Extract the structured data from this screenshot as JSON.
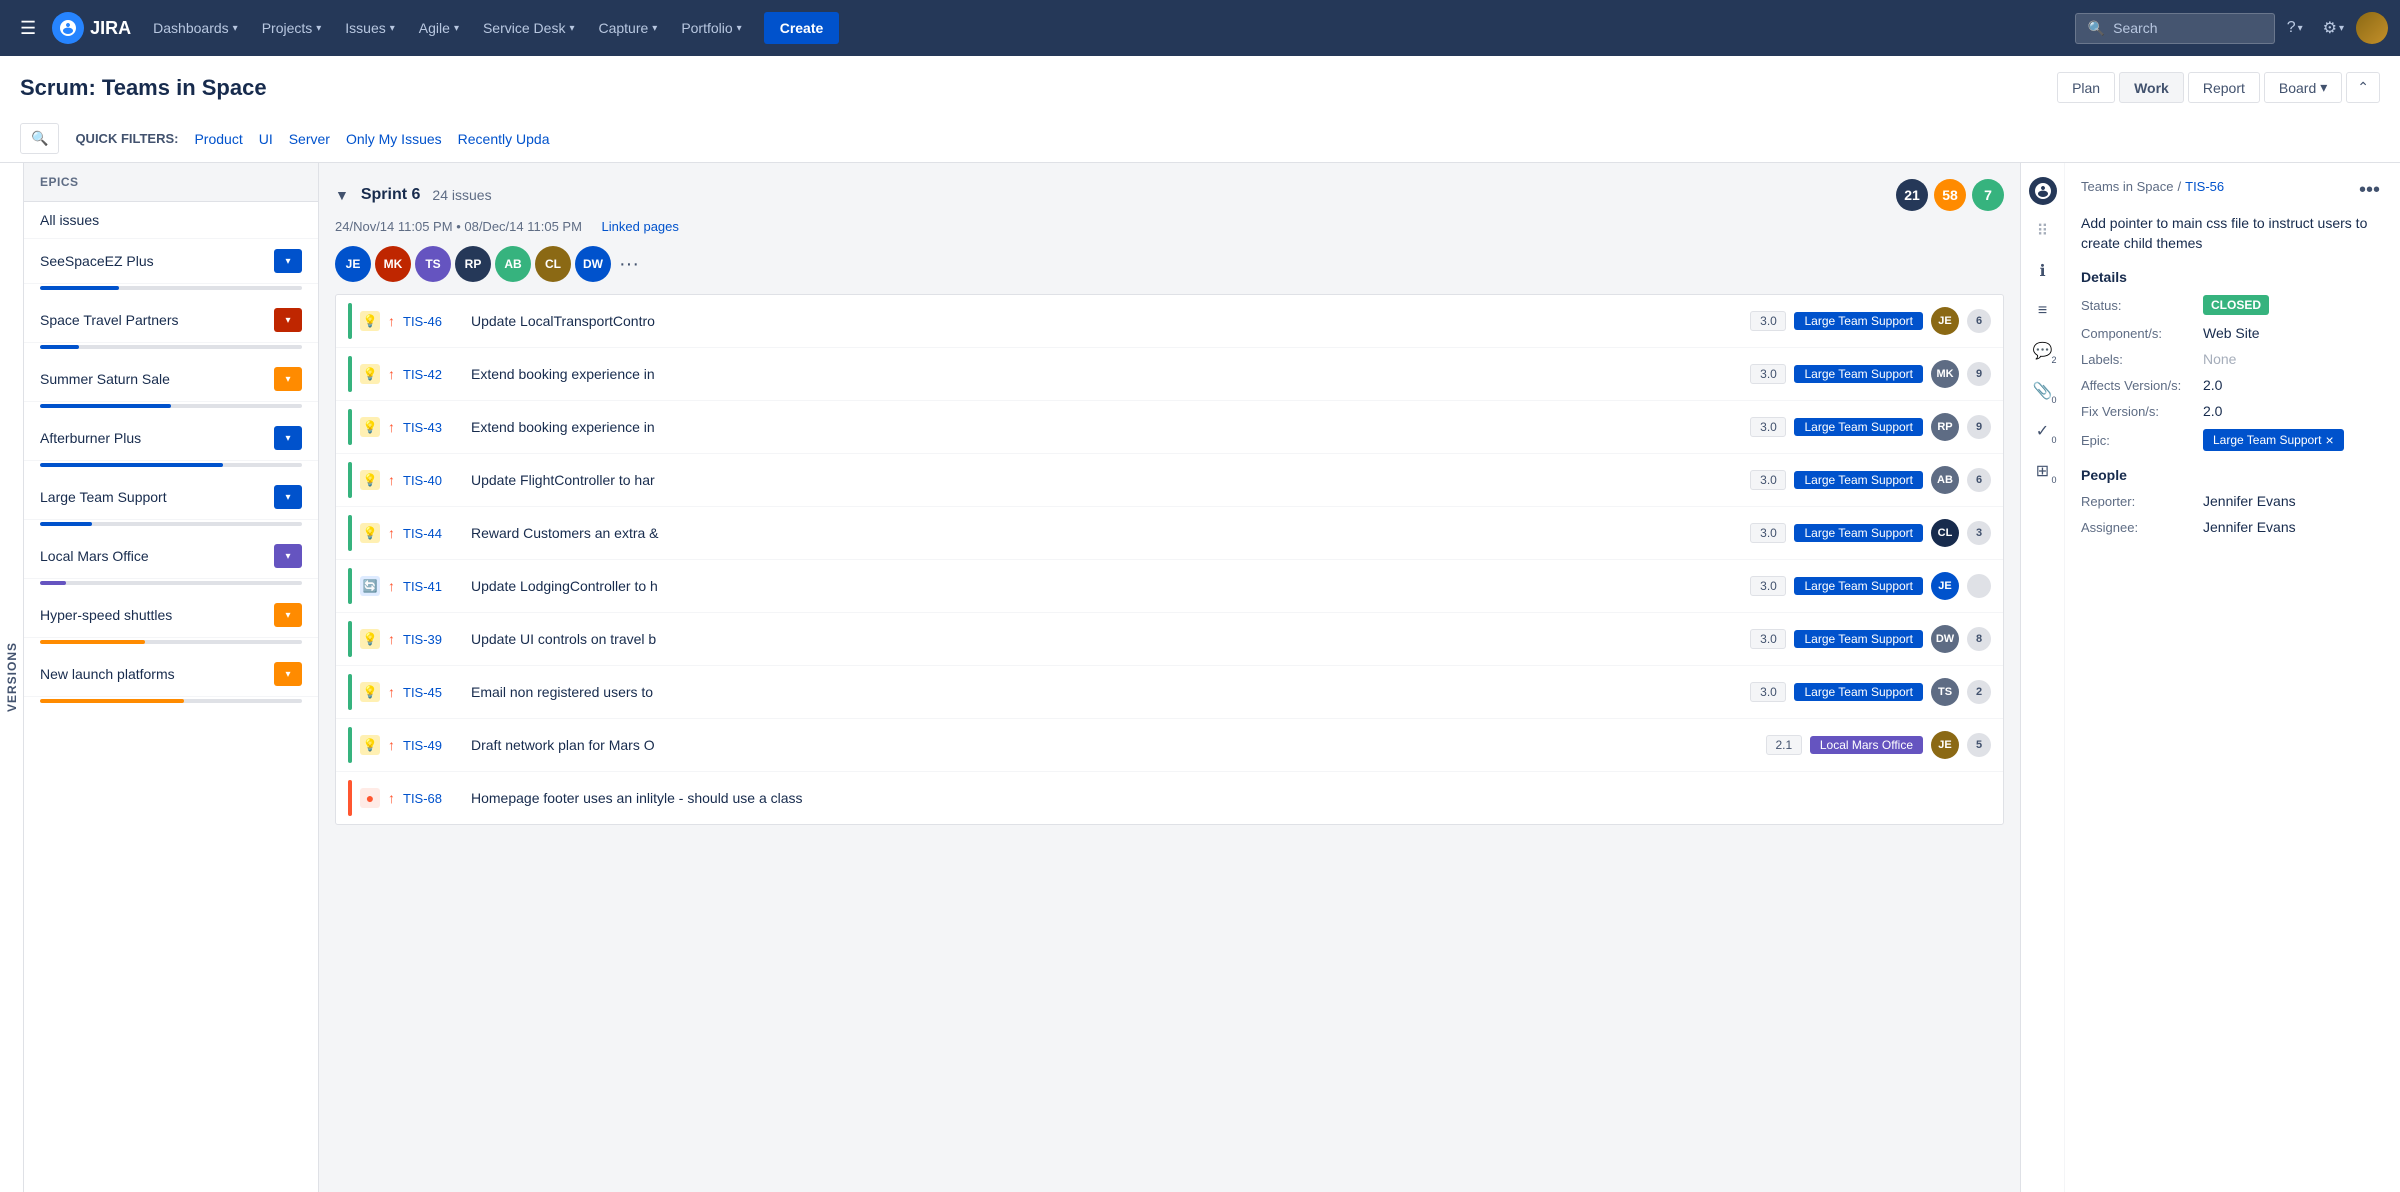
{
  "nav": {
    "hamburger": "☰",
    "logo_text": "JIRA",
    "items": [
      {
        "label": "Dashboards",
        "has_arrow": true
      },
      {
        "label": "Projects",
        "has_arrow": true
      },
      {
        "label": "Issues",
        "has_arrow": true
      },
      {
        "label": "Agile",
        "has_arrow": true
      },
      {
        "label": "Service Desk",
        "has_arrow": true
      },
      {
        "label": "Capture",
        "has_arrow": true
      },
      {
        "label": "Portfolio",
        "has_arrow": true
      }
    ],
    "create_label": "Create",
    "search_placeholder": "Search",
    "help_icon": "?",
    "settings_icon": "⚙"
  },
  "page": {
    "title": "Scrum: Teams in Space"
  },
  "view_buttons": [
    {
      "label": "Plan",
      "active": false
    },
    {
      "label": "Work",
      "active": true
    },
    {
      "label": "Report",
      "active": false
    },
    {
      "label": "Board",
      "active": false,
      "has_arrow": true
    }
  ],
  "quick_filters": {
    "label": "QUICK FILTERS:",
    "items": [
      {
        "label": "Product"
      },
      {
        "label": "UI"
      },
      {
        "label": "Server"
      },
      {
        "label": "Only My Issues"
      },
      {
        "label": "Recently Upda"
      }
    ]
  },
  "epics": {
    "header": "EPICS",
    "items": [
      {
        "name": "All issues",
        "color": null,
        "progress": 0
      },
      {
        "name": "SeeSpaceEZ Plus",
        "color": "#0052CC",
        "progress": 30,
        "btn_color": "#0052CC"
      },
      {
        "name": "Space Travel Partners",
        "color": "#BF2600",
        "progress": 15,
        "btn_color": "#BF2600"
      },
      {
        "name": "Summer Saturn Sale",
        "color": "#FF8B00",
        "progress": 50,
        "btn_color": "#FF8B00"
      },
      {
        "name": "Afterburner Plus",
        "color": "#0052CC",
        "progress": 70,
        "btn_color": "#0052CC"
      },
      {
        "name": "Large Team Support",
        "color": "#0052CC",
        "progress": 20,
        "btn_color": "#0052CC"
      },
      {
        "name": "Local Mars Office",
        "color": "#6554C0",
        "progress": 10,
        "btn_color": "#6554C0"
      },
      {
        "name": "Hyper-speed shuttles",
        "color": "#FF8B00",
        "progress": 40,
        "btn_color": "#FF8B00"
      },
      {
        "name": "New launch platforms",
        "color": "#FF8B00",
        "progress": 55,
        "btn_color": "#FF8B00"
      }
    ]
  },
  "sprint": {
    "name": "Sprint 6",
    "issue_count": "24 issues",
    "chevron": "▼",
    "badges": [
      {
        "count": "21",
        "color": "#253858"
      },
      {
        "count": "58",
        "color": "#FF8B00"
      },
      {
        "count": "7",
        "color": "#36B37E"
      }
    ],
    "date_start": "24/Nov/14 11:05 PM",
    "date_sep": "•",
    "date_end": "08/Dec/14 11:05 PM",
    "linked_pages": "Linked pages",
    "avatars": [
      {
        "initials": "JE",
        "color": "#0052CC"
      },
      {
        "initials": "MK",
        "color": "#BF2600"
      },
      {
        "initials": "TS",
        "color": "#6554C0"
      },
      {
        "initials": "RP",
        "color": "#253858"
      },
      {
        "initials": "AB",
        "color": "#36B37E"
      },
      {
        "initials": "CL",
        "color": "#8B6914"
      },
      {
        "initials": "DW",
        "color": "#0052CC"
      }
    ],
    "more_avatars": "..."
  },
  "issues": [
    {
      "left_color": "#36B37E",
      "type_icon": "💡",
      "type_color": "#FFF0B3",
      "priority": "↑",
      "priority_color": "#FF5630",
      "key": "TIS-46",
      "summary": "Update LocalTransportContro",
      "points": "3.0",
      "epic": "Large Team Support",
      "epic_color": "#0052CC",
      "assignee_initials": "JE",
      "assignee_color": "#8B6914",
      "story_pts": "6"
    },
    {
      "left_color": "#36B37E",
      "type_icon": "💡",
      "type_color": "#FFF0B3",
      "priority": "↑",
      "priority_color": "#FF5630",
      "key": "TIS-42",
      "summary": "Extend booking experience in",
      "points": "3.0",
      "epic": "Large Team Support",
      "epic_color": "#0052CC",
      "assignee_initials": "MK",
      "assignee_color": "#5E6C84",
      "story_pts": "9"
    },
    {
      "left_color": "#36B37E",
      "type_icon": "💡",
      "type_color": "#FFF0B3",
      "priority": "↑",
      "priority_color": "#FF5630",
      "key": "TIS-43",
      "summary": "Extend booking experience in",
      "points": "3.0",
      "epic": "Large Team Support",
      "epic_color": "#0052CC",
      "assignee_initials": "RP",
      "assignee_color": "#5E6C84",
      "story_pts": "9"
    },
    {
      "left_color": "#36B37E",
      "type_icon": "💡",
      "type_color": "#FFF0B3",
      "priority": "↑",
      "priority_color": "#FF5630",
      "key": "TIS-40",
      "summary": "Update FlightController to har",
      "points": "3.0",
      "epic": "Large Team Support",
      "epic_color": "#0052CC",
      "assignee_initials": "AB",
      "assignee_color": "#5E6C84",
      "story_pts": "6"
    },
    {
      "left_color": "#36B37E",
      "type_icon": "💡",
      "type_color": "#FFF0B3",
      "priority": "↑",
      "priority_color": "#FF5630",
      "key": "TIS-44",
      "summary": "Reward Customers an extra &",
      "points": "3.0",
      "epic": "Large Team Support",
      "epic_color": "#0052CC",
      "assignee_initials": "CL",
      "assignee_color": "#172B4D",
      "story_pts": "3"
    },
    {
      "left_color": "#36B37E",
      "type_icon": "🔄",
      "type_color": "#DEEBFF",
      "priority": "↑",
      "priority_color": "#FF5630",
      "key": "TIS-41",
      "summary": "Update LodgingController to h",
      "points": "3.0",
      "epic": "Large Team Support",
      "epic_color": "#0052CC",
      "assignee_initials": "JE",
      "assignee_color": "#0052CC",
      "story_pts": ""
    },
    {
      "left_color": "#36B37E",
      "type_icon": "💡",
      "type_color": "#FFF0B3",
      "priority": "↑",
      "priority_color": "#FF5630",
      "key": "TIS-39",
      "summary": "Update UI controls on travel b",
      "points": "3.0",
      "epic": "Large Team Support",
      "epic_color": "#0052CC",
      "assignee_initials": "DW",
      "assignee_color": "#5E6C84",
      "story_pts": "8"
    },
    {
      "left_color": "#36B37E",
      "type_icon": "💡",
      "type_color": "#FFF0B3",
      "priority": "↑",
      "priority_color": "#FF5630",
      "key": "TIS-45",
      "summary": "Email non registered users to",
      "points": "3.0",
      "epic": "Large Team Support",
      "epic_color": "#0052CC",
      "assignee_initials": "TS",
      "assignee_color": "#5E6C84",
      "story_pts": "2"
    },
    {
      "left_color": "#36B37E",
      "type_icon": "💡",
      "type_color": "#FFF0B3",
      "priority": "↑",
      "priority_color": "#FF5630",
      "key": "TIS-49",
      "summary": "Draft network plan for Mars O",
      "points": "2.1",
      "epic": "Local Mars Office",
      "epic_color": "#6554C0",
      "assignee_initials": "JE",
      "assignee_color": "#8B6914",
      "story_pts": "5"
    },
    {
      "left_color": "#FF5630",
      "type_icon": "🔴",
      "type_color": "#FFEBE6",
      "priority": "↑",
      "priority_color": "#FF5630",
      "key": "TIS-68",
      "summary": "Homepage footer uses an inlityle - should use a class",
      "points": "",
      "epic": "",
      "epic_color": "",
      "assignee_initials": "",
      "assignee_color": "",
      "story_pts": ""
    }
  ],
  "detail": {
    "breadcrumb_project": "Teams in Space",
    "breadcrumb_sep": "/",
    "breadcrumb_issue": "TIS-56",
    "more_btn": "•••",
    "description": "Add pointer to main css file to instruct users to create child themes",
    "section_details": "Details",
    "fields": [
      {
        "label": "Status:",
        "value": "CLOSED",
        "type": "status"
      },
      {
        "label": "Component/s:",
        "value": "Web Site",
        "type": "text"
      },
      {
        "label": "Labels:",
        "value": "None",
        "type": "none"
      },
      {
        "label": "Affects Version/s:",
        "value": "2.0",
        "type": "text"
      },
      {
        "label": "Fix Version/s:",
        "value": "2.0",
        "type": "text"
      },
      {
        "label": "Epic:",
        "value": "Large Team Support ×",
        "type": "epic"
      }
    ],
    "section_people": "People",
    "reporter_label": "Reporter:",
    "reporter_value": "Jennifer Evans",
    "assignee_label": "Assignee:",
    "assignee_value": "Jennifer Evans"
  },
  "side_icons": [
    {
      "icon": "⚙",
      "badge": ""
    },
    {
      "icon": "ℹ",
      "badge": ""
    },
    {
      "icon": "≡",
      "badge": ""
    },
    {
      "icon": "💬",
      "badge": "2"
    },
    {
      "icon": "📎",
      "badge": "0"
    },
    {
      "icon": "✓",
      "badge": "0"
    },
    {
      "icon": "⊞",
      "badge": "0"
    }
  ]
}
